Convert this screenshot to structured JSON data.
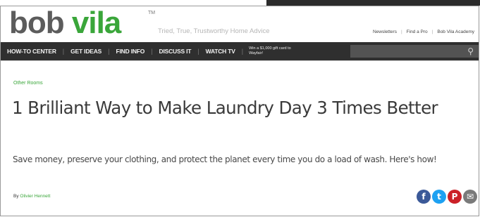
{
  "header": {
    "logo_part1": "bob",
    "logo_part2": "vila",
    "trademark": "TM",
    "tagline": "Tried, True, Trustworthy Home Advice",
    "utility_links": [
      "Newsletters",
      "Find a Pro",
      "Bob Vila Academy"
    ]
  },
  "nav": {
    "items": [
      "HOW-TO CENTER",
      "GET IDEAS",
      "FIND INFO",
      "DISCUSS IT",
      "WATCH TV"
    ],
    "promo": "Win a $1,000 gift card to Wayfair!",
    "search_placeholder": ""
  },
  "article": {
    "category": "Other Rooms",
    "title": "1 Brilliant Way to Make Laundry Day 3 Times Better",
    "dek": "Save money, preserve your clothing, and protect the planet every time you do a load of wash. Here's how!",
    "byline_prefix": "By",
    "author": "Olivier Hennett"
  },
  "share": {
    "icons": [
      "facebook-icon",
      "twitter-icon",
      "pinterest-icon",
      "email-icon"
    ],
    "glyphs": [
      "f",
      "t",
      "P",
      "✉"
    ],
    "colors": [
      "#3b5998",
      "#1da1f2",
      "#cb2027",
      "#7a7a7a"
    ]
  },
  "colors": {
    "brand_green": "#3aa63a",
    "nav_bg": "#2f2f2f"
  }
}
